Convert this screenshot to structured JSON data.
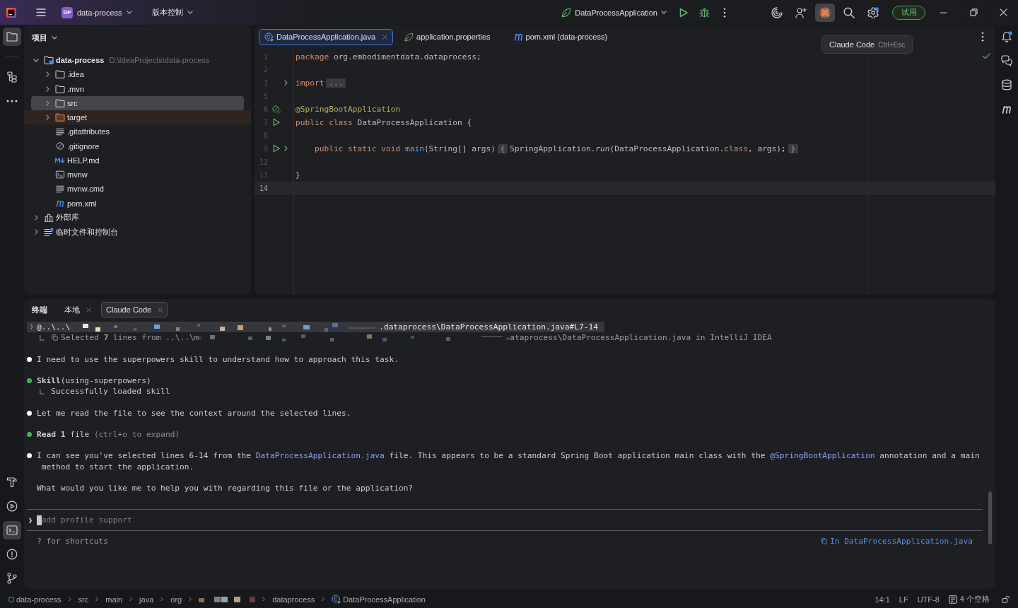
{
  "title_bar": {
    "project_badge": "DP",
    "project_name": "data-process",
    "vcs_menu": "版本控制",
    "run_configuration": "DataProcessApplication",
    "actions": [
      {
        "kind": "ai",
        "selected": false,
        "badge": false
      },
      {
        "kind": "collaborate",
        "selected": false,
        "badge": false
      },
      {
        "kind": "claude",
        "selected": true,
        "badge": false
      },
      {
        "kind": "search",
        "selected": false,
        "badge": false
      },
      {
        "kind": "settings",
        "selected": false,
        "badge": true
      }
    ],
    "trial_button": "试用"
  },
  "left_toolbar": {
    "top": [
      {
        "kind": "project",
        "selected": true
      },
      {
        "kind": "structure",
        "selected": false
      },
      {
        "kind": "more",
        "selected": false
      }
    ],
    "bottom": [
      {
        "kind": "build",
        "selected": false
      },
      {
        "kind": "services",
        "selected": false
      },
      {
        "kind": "terminal",
        "selected": true
      },
      {
        "kind": "problems",
        "selected": false
      },
      {
        "kind": "git",
        "selected": false
      }
    ]
  },
  "project": {
    "title": "项目",
    "tree": [
      {
        "kind": "module",
        "label": "data-process",
        "path": "D:\\IdeaProjects\\data-process",
        "expanded": true,
        "selected": false,
        "children": [
          {
            "kind": "folder",
            "label": ".idea",
            "expanded": false,
            "selected": false
          },
          {
            "kind": "folder",
            "label": ".mvn",
            "expanded": false,
            "selected": false
          },
          {
            "kind": "folder",
            "label": "src",
            "expanded": false,
            "selected": true
          },
          {
            "kind": "excluded",
            "label": "target",
            "expanded": false,
            "selected": false
          },
          {
            "kind": "text",
            "label": ".gitattributes",
            "selected": false
          },
          {
            "kind": "ignore",
            "label": ".gitignore",
            "selected": false
          },
          {
            "kind": "markdown",
            "label": "HELP.md",
            "selected": false
          },
          {
            "kind": "script",
            "label": "mvnw",
            "selected": false
          },
          {
            "kind": "text",
            "label": "mvnw.cmd",
            "selected": false
          },
          {
            "kind": "maven",
            "label": "pom.xml",
            "selected": false
          }
        ]
      },
      {
        "kind": "library",
        "label": "外部库",
        "expanded": false,
        "selected": false
      },
      {
        "kind": "scratches",
        "label": "临时文件和控制台",
        "expanded": false,
        "selected": false
      }
    ]
  },
  "editor": {
    "tabs": [
      {
        "kind": "java",
        "label": "DataProcessApplication.java",
        "selected": true
      },
      {
        "kind": "properties",
        "label": "application.properties",
        "selected": false
      },
      {
        "kind": "maven",
        "label": "pom.xml (data-process)",
        "selected": false
      }
    ],
    "tooltip": {
      "title": "Claude Code",
      "shortcut": "Ctrl+Esc"
    },
    "lines": [
      {
        "number": "1",
        "current": false,
        "fold": false,
        "tokens": [
          {
            "kind": "keyword",
            "text": "package"
          },
          {
            "kind": "plain",
            "text": " org.embodimentdata.dataprocess;"
          }
        ]
      },
      {
        "number": "2",
        "current": false,
        "fold": false
      },
      {
        "number": "3",
        "current": false,
        "fold": true,
        "tokens": [
          {
            "kind": "keyword",
            "text": "import"
          },
          {
            "kind": "folded",
            "text": "..."
          }
        ]
      },
      {
        "number": "5",
        "current": false,
        "fold": false
      },
      {
        "number": "6",
        "current": false,
        "fold": false,
        "gutter": {
          "kind": "bean"
        },
        "tokens": [
          {
            "kind": "annotation",
            "text": "@SpringBootApplication"
          }
        ]
      },
      {
        "number": "7",
        "current": false,
        "fold": false,
        "gutter": {
          "kind": "run"
        },
        "tokens": [
          {
            "kind": "keyword",
            "text": "public class"
          },
          {
            "kind": "plain",
            "text": " DataProcessApplication {"
          }
        ]
      },
      {
        "number": "8",
        "current": false,
        "fold": false
      },
      {
        "number": "9",
        "current": false,
        "fold": true,
        "gutter": {
          "kind": "run"
        },
        "tokens": [
          {
            "kind": "keyword",
            "text": "    public static void "
          },
          {
            "kind": "method",
            "text": "main"
          },
          {
            "kind": "plain",
            "text": "(String[] args)"
          },
          {
            "kind": "folded",
            "text": "{"
          },
          {
            "kind": "plain",
            "text": "SpringApplication."
          },
          {
            "kind": "static-call",
            "text": "run"
          },
          {
            "kind": "plain",
            "text": "(DataProcessApplication."
          },
          {
            "kind": "keyword",
            "text": "class"
          },
          {
            "kind": "plain",
            "text": ", args);"
          },
          {
            "kind": "folded",
            "text": "}"
          }
        ]
      },
      {
        "number": "12",
        "current": false,
        "fold": false
      },
      {
        "number": "13",
        "current": false,
        "fold": false,
        "tokens": [
          {
            "kind": "plain",
            "text": "}"
          }
        ]
      },
      {
        "number": "14",
        "current": true,
        "fold": false
      }
    ]
  },
  "right_toolbar": [
    {
      "kind": "notifications",
      "badge": true
    },
    {
      "kind": "ai-chat",
      "badge": false
    },
    {
      "kind": "database",
      "badge": false
    },
    {
      "kind": "maven",
      "badge": false
    }
  ],
  "terminal": {
    "title": "终端",
    "tabs": [
      {
        "label": "本地",
        "selected": false
      },
      {
        "label": "Claude Code",
        "selected": true
      }
    ],
    "entries": [
      {
        "kind": "mention",
        "prompt": "❯",
        "before": "@..\\..\\",
        "after": ".dataprocess\\DataProcessApplication.java#L7-14",
        "redacted": true
      },
      {
        "kind": "attachment",
        "before": "Selected **7** lines from ..\\..\\m",
        "after": "ataprocess\\DataProcessApplication.java in IntelliJ IDEA",
        "redacted": true
      },
      {
        "kind": "message",
        "color": "#ffffff",
        "segments": [
          {
            "text": "I need to use the superpowers skill to understand how to approach this task."
          }
        ]
      },
      {
        "kind": "tool",
        "color": "#4caf50",
        "text": "**Skill**(using-superpowers)",
        "result": "Successfully loaded skill"
      },
      {
        "kind": "message",
        "color": "#ffffff",
        "segments": [
          {
            "text": "Let me read the file to see the context around the selected lines."
          }
        ]
      },
      {
        "kind": "tool",
        "color": "#4caf50",
        "text": "**Read** **1** file",
        "hint": "(ctrl+o to expand)"
      },
      {
        "kind": "message",
        "color": "#ffffff",
        "segments": [
          {
            "text": "I can see you've selected lines 6-14 from the "
          },
          {
            "kind": "code",
            "text": "DataProcessApplication.java"
          },
          {
            "text": " file. This appears to be a standard Spring Boot application main class with the "
          },
          {
            "kind": "code",
            "text": "@SpringBootApplication"
          },
          {
            "text": " annotation and a main method to start the application."
          }
        ]
      },
      {
        "kind": "plain",
        "segments": [
          {
            "text": "What would you like me to help you with regarding this file or the application?"
          }
        ]
      }
    ],
    "input": {
      "prompt": "❯",
      "placeholder": "add profile support"
    },
    "footer": {
      "hint": "? for shortcuts",
      "context": "In DataProcessApplication.java"
    }
  },
  "status_bar": {
    "breadcrumbs": [
      {
        "kind": "module",
        "label": "data-process"
      },
      {
        "kind": "folder",
        "label": "src"
      },
      {
        "kind": "folder",
        "label": "main"
      },
      {
        "kind": "folder",
        "label": "java"
      },
      {
        "kind": "folder",
        "label": "org"
      },
      {
        "kind": "redacted"
      },
      {
        "kind": "folder",
        "label": "dataprocess"
      },
      {
        "kind": "class",
        "label": "DataProcessApplication"
      }
    ],
    "position": "14:1",
    "line_separator": "LF",
    "encoding": "UTF-8",
    "indent": "4 个空格"
  }
}
